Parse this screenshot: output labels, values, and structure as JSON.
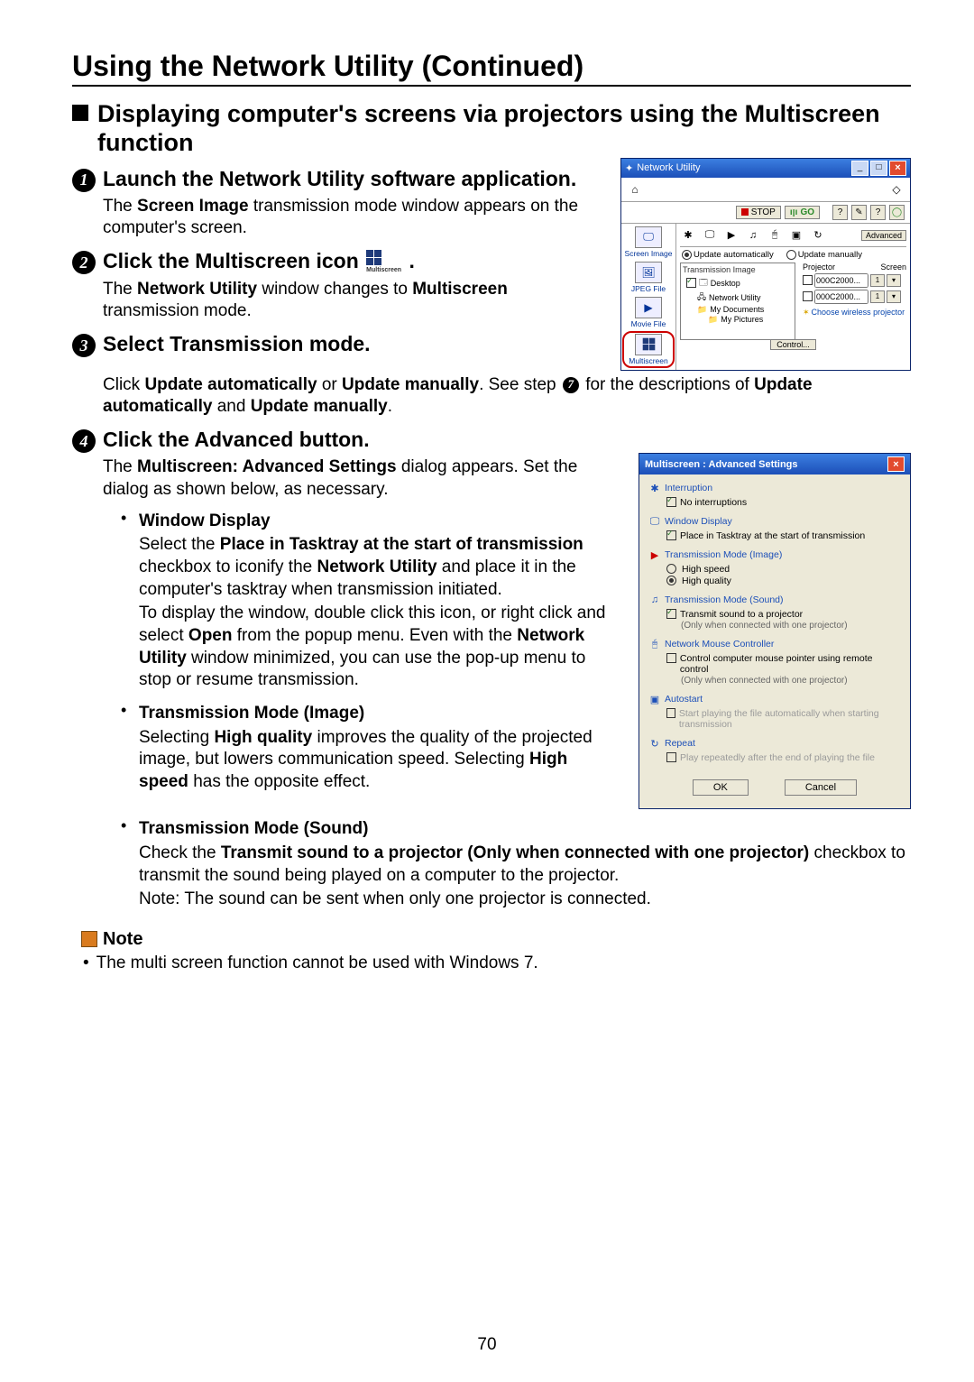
{
  "page_number": "70",
  "h1": "Using the Network Utility (Continued)",
  "h2": "Displaying computer's screens via projectors using the Multiscreen function",
  "steps": {
    "s1": {
      "title": "Launch the Network Utility software application.",
      "p1a": "The ",
      "p1b": "Screen Image",
      "p1c": " transmission mode window appears on the computer's screen."
    },
    "s2": {
      "title_a": "Click the Multiscreen icon ",
      "title_b": ".",
      "ms_label": "Multiscreen",
      "p1a": "The ",
      "p1b": "Network Utility",
      "p1c": " window changes to ",
      "p1d": "Multiscreen",
      "p1e": " transmission mode."
    },
    "s3": {
      "title": "Select Transmission mode.",
      "p1a": "Click ",
      "p1b": "Update automatically",
      "p1c": " or ",
      "p1d": "Update manually",
      "p1e": ". See step ",
      "p1f": " for the descriptions of ",
      "p1g": "Update automatically",
      "p1h": " and ",
      "p1i": "Update manually",
      "p1j": ".",
      "ref_step": "7"
    },
    "s4": {
      "title": "Click the Advanced button.",
      "p1a": "The ",
      "p1b": "Multiscreen: Advanced Settings",
      "p1c": " dialog appears. Set the dialog as shown below, as necessary."
    }
  },
  "bulletA": {
    "title": "Window Display",
    "p1a": "Select the ",
    "p1b": "Place in Tasktray at the start of transmission",
    "p1c": " checkbox to iconify the ",
    "p1d": "Network Utility",
    "p1e": " and place it in the computer's tasktray when transmission initiated.",
    "p2a": "To display the window, double click this icon, or right click and select ",
    "p2b": "Open",
    "p2c": " from the popup menu. Even with the ",
    "p2d": "Network Utility",
    "p2e": " window minimized, you can use the pop-up menu to stop or resume transmission."
  },
  "bulletB": {
    "title": "Transmission Mode (Image)",
    "p1a": "Selecting ",
    "p1b": "High quality",
    "p1c": " improves the quality of the projected image, but lowers communication speed. Selecting ",
    "p1d": "High speed",
    "p1e": " has the opposite effect."
  },
  "bulletC": {
    "title": "Transmission Mode (Sound)",
    "p1a": "Check the ",
    "p1b": "Transmit sound to a projector (Only when connected with one projector)",
    "p1c": " checkbox to transmit the sound being played on a computer to the projector.",
    "p2": "Note: The sound can be sent when only one projector is connected."
  },
  "note": {
    "label": "Note",
    "item1": "The multi screen function cannot be used with Windows 7."
  },
  "nu_window": {
    "title": "Network Utility",
    "stop": "STOP",
    "go": "GO",
    "side": {
      "screen_image": "Screen Image",
      "jpeg_file": "JPEG File",
      "movie_file": "Movie File",
      "multiscreen": "Multiscreen"
    },
    "advanced_btn": "Advanced",
    "update_auto": "Update automatically",
    "update_manual": "Update manually",
    "trans_image_hdr": "Transmission Image",
    "tree": {
      "desktop": "Desktop",
      "netutil": "Network Utility",
      "mydocs": "My Documents",
      "mypics": "My Pictures"
    },
    "projector_hdr": "Projector",
    "screen_hdr": "Screen",
    "proj1": "000C2000...",
    "proj2": "000C2000...",
    "p1screen": "1",
    "p2screen": "1",
    "control_btn": "Control...",
    "wireless": "Choose wireless projector"
  },
  "adv_dialog": {
    "title": "Multiscreen : Advanced Settings",
    "interruption": {
      "hdr": "Interruption",
      "opt1": "No interruptions"
    },
    "window_display": {
      "hdr": "Window Display",
      "opt1": "Place in Tasktray at the start of transmission"
    },
    "tm_image": {
      "hdr": "Transmission Mode (Image)",
      "opt1": "High speed",
      "opt2": "High quality"
    },
    "tm_sound": {
      "hdr": "Transmission Mode (Sound)",
      "opt1": "Transmit sound to a projector",
      "sub": "(Only when connected with one projector)"
    },
    "mouse": {
      "hdr": "Network Mouse Controller",
      "opt1": "Control computer mouse pointer using remote control",
      "sub": "(Only when connected with one projector)"
    },
    "autostart": {
      "hdr": "Autostart",
      "opt1": "Start playing the file automatically when starting transmission"
    },
    "repeat": {
      "hdr": "Repeat",
      "opt1": "Play repeatedly after the end of playing the file"
    },
    "ok": "OK",
    "cancel": "Cancel"
  }
}
